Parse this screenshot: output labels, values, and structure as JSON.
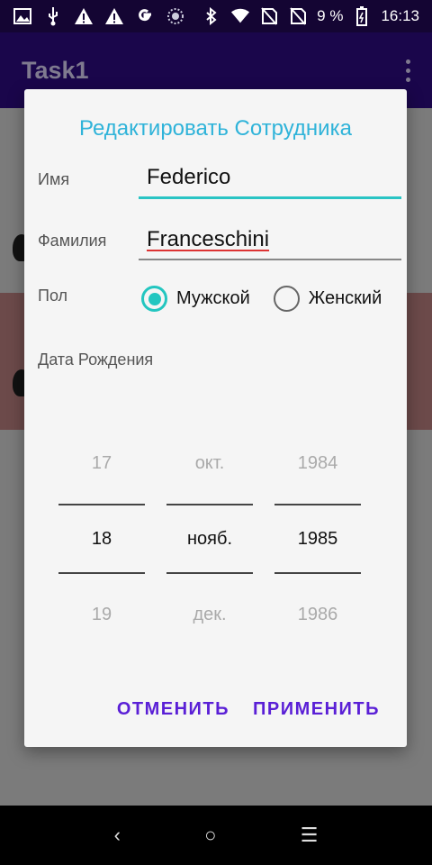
{
  "status_bar": {
    "battery": "9 %",
    "time": "16:13"
  },
  "app_bar": {
    "title": "Task1"
  },
  "dialog": {
    "title": "Редактировать Сотрудника",
    "first_name": {
      "label": "Имя",
      "value": "Federico"
    },
    "last_name": {
      "label": "Фамилия",
      "value": "Franceschini"
    },
    "gender": {
      "label": "Пол",
      "options": [
        "Мужской",
        "Женский"
      ],
      "selected": "Мужской"
    },
    "birth_date": {
      "label": "Дата Рождения",
      "day": {
        "prev": "17",
        "value": "18",
        "next": "19"
      },
      "month": {
        "prev": "окт.",
        "value": "нояб.",
        "next": "дек."
      },
      "year": {
        "prev": "1984",
        "value": "1985",
        "next": "1986"
      }
    },
    "cancel_label": "ОТМЕНИТЬ",
    "apply_label": "ПРИМЕНИТЬ"
  },
  "nav_bar": {
    "back": "‹",
    "home": "○",
    "recents": "☰"
  },
  "colors": {
    "accent": "#23c6c0",
    "title": "#2fb3d9",
    "button": "#5a1fd6",
    "app_bar": "#1a064b"
  }
}
